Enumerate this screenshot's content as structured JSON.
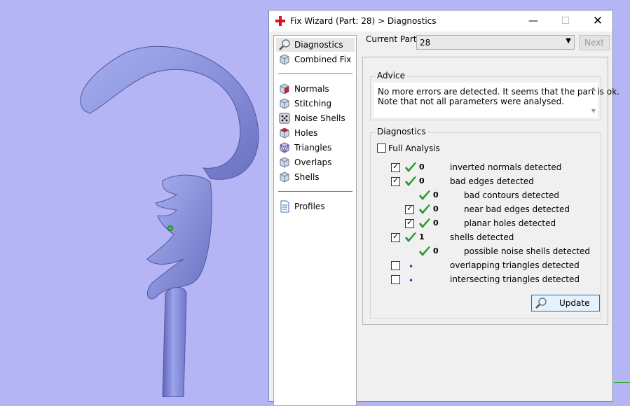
{
  "window": {
    "title": "Fix Wizard (Part: 28) > Diagnostics",
    "minimize_glyph": "—",
    "maximize_glyph": "☐",
    "close_glyph": "✕"
  },
  "nav": {
    "items": [
      {
        "label": "Diagnostics",
        "icon": "magnifier-icon",
        "active": true
      },
      {
        "label": "Combined Fix",
        "icon": "cube-icon"
      },
      {
        "label": "Normals",
        "icon": "cube-red-face-icon"
      },
      {
        "label": "Stitching",
        "icon": "cube-icon"
      },
      {
        "label": "Noise Shells",
        "icon": "dice-icon"
      },
      {
        "label": "Holes",
        "icon": "cube-red-face-icon"
      },
      {
        "label": "Triangles",
        "icon": "cube-triangles-icon"
      },
      {
        "label": "Overlaps",
        "icon": "cube-icon"
      },
      {
        "label": "Shells",
        "icon": "cube-icon"
      },
      {
        "label": "Profiles",
        "icon": "document-icon"
      }
    ]
  },
  "current_part": {
    "label": "Current Part:",
    "value": "28",
    "next_label": "Next"
  },
  "advice": {
    "title": "Advice",
    "lines": [
      "No more errors are detected. It seems that the part is ok.",
      "Note that not all parameters were analysed."
    ]
  },
  "diagnostics": {
    "title": "Diagnostics",
    "full_analysis": {
      "label": "Full Analysis",
      "checked": false
    },
    "rows": [
      {
        "checkbox": true,
        "checked": true,
        "status": "ok",
        "count": "0",
        "text": "inverted normals detected",
        "indent": 0
      },
      {
        "checkbox": true,
        "checked": true,
        "status": "ok",
        "count": "0",
        "text": "bad edges detected",
        "indent": 0
      },
      {
        "checkbox": false,
        "checked": false,
        "status": "ok",
        "count": "0",
        "text": "bad contours detected",
        "indent": 1
      },
      {
        "checkbox": true,
        "checked": true,
        "status": "ok",
        "count": "0",
        "text": "near bad edges detected",
        "indent": 1
      },
      {
        "checkbox": true,
        "checked": true,
        "status": "ok",
        "count": "0",
        "text": "planar holes detected",
        "indent": 1
      },
      {
        "checkbox": true,
        "checked": true,
        "status": "ok",
        "count": "1",
        "text": "shells detected",
        "indent": 0
      },
      {
        "checkbox": false,
        "checked": false,
        "status": "ok",
        "count": "0",
        "text": "possible noise shells detected",
        "indent": 1
      },
      {
        "checkbox": true,
        "checked": false,
        "status": "dot",
        "count": "",
        "text": "overlapping triangles detected",
        "indent": 0
      },
      {
        "checkbox": true,
        "checked": false,
        "status": "dot",
        "count": "",
        "text": "intersecting triangles detected",
        "indent": 0
      }
    ],
    "update_label": "Update"
  },
  "colors": {
    "viewport_bg": "#b5b5f5",
    "model": "#8791dc",
    "check_green": "#1f9a2f",
    "selection_blue": "#0078d7"
  }
}
